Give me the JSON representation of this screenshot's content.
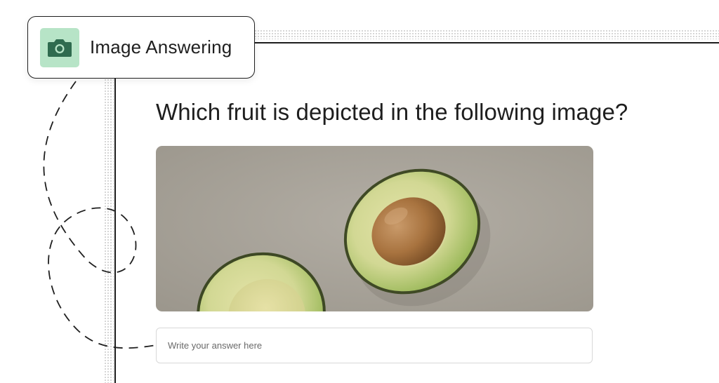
{
  "badge": {
    "icon": "camera-icon",
    "label": "Image Answering",
    "icon_bg": "#b7e4c7",
    "icon_color": "#2f6b4f"
  },
  "question": {
    "title": "Which fruit is depicted in the following image?"
  },
  "image": {
    "subject": "avocado halves",
    "bg": "#a8a39a"
  },
  "answer": {
    "placeholder": "Write your answer here",
    "value": ""
  }
}
